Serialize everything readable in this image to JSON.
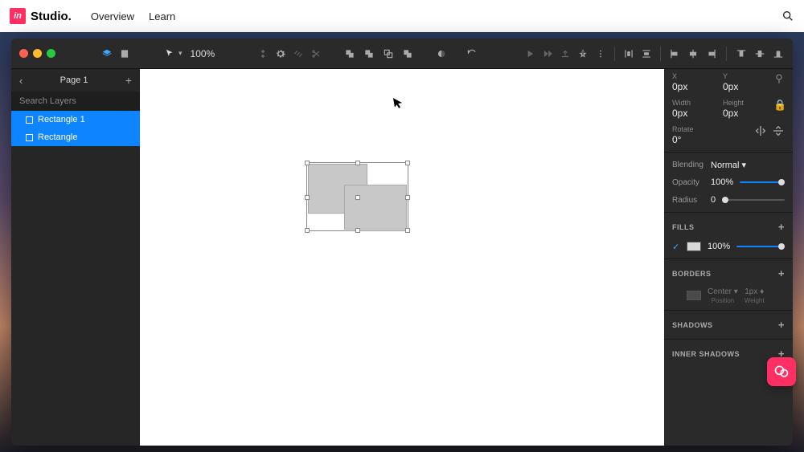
{
  "topnav": {
    "brand": "Studio.",
    "links": [
      "Overview",
      "Learn"
    ]
  },
  "toolbar": {
    "zoom": "100%"
  },
  "sidebar": {
    "page_title": "Page 1",
    "search_placeholder": "Search Layers",
    "layers": [
      "Rectangle 1",
      "Rectangle"
    ]
  },
  "inspector": {
    "x_label": "X",
    "x_val": "0px",
    "y_label": "Y",
    "y_val": "0px",
    "w_label": "Width",
    "w_val": "0px",
    "h_label": "Height",
    "h_val": "0px",
    "rot_label": "Rotate",
    "rot_val": "0°",
    "blending_label": "Blending",
    "blending_val": "Normal",
    "opacity_label": "Opacity",
    "opacity_val": "100%",
    "radius_label": "Radius",
    "radius_val": "0",
    "fills_title": "FILLS",
    "fill_opacity": "100%",
    "borders_title": "BORDERS",
    "border_pos": "Center",
    "border_pos_sub": "Position",
    "border_w": "1px",
    "border_w_sub": "Weight",
    "shadows_title": "SHADOWS",
    "inner_shadows_title": "INNER SHADOWS"
  }
}
